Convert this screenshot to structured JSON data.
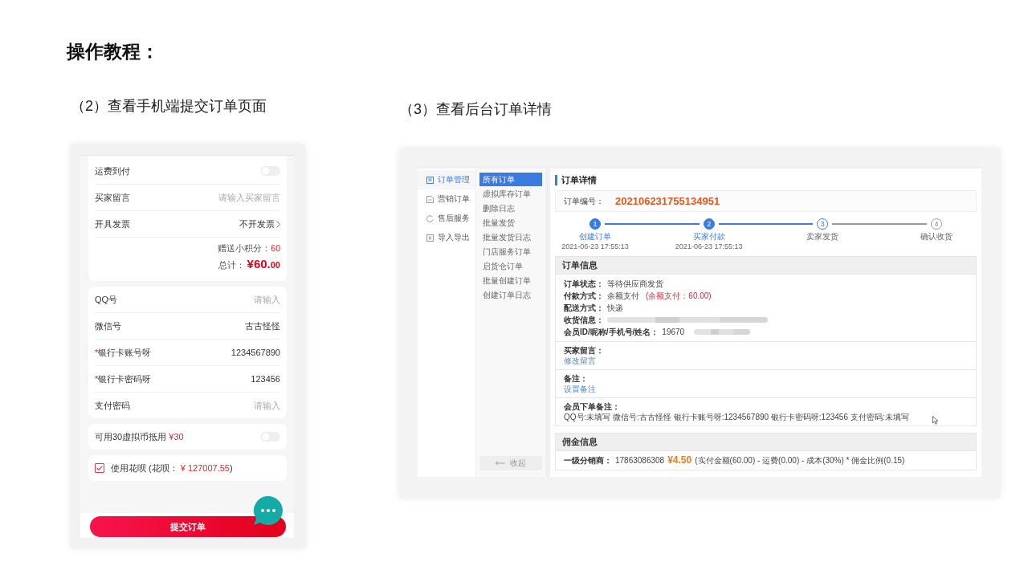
{
  "page_title": "操作教程：",
  "mobile": {
    "caption": "（2）查看手机端提交订单页面",
    "cards": [
      {
        "rows": [
          {
            "kind": "toggle",
            "label": "运费到付",
            "on": false
          },
          {
            "kind": "input",
            "label": "买家留言",
            "placeholder": "请输入买家留言"
          },
          {
            "kind": "select",
            "label": "开具发票",
            "value": "不开发票"
          }
        ],
        "summary": {
          "points_label": "赠送小积分：",
          "points": "60",
          "total_label": "总计：",
          "total_amount": "¥60.",
          "total_cents": "00"
        }
      },
      {
        "rows": [
          {
            "kind": "input",
            "label": "QQ号",
            "placeholder": "请输入"
          },
          {
            "kind": "input",
            "label": "微信号",
            "value": "古古怪怪"
          },
          {
            "kind": "input",
            "label": "银行卡账号呀",
            "required_mark": "*",
            "value": "1234567890"
          },
          {
            "kind": "input",
            "label": "银行卡密码呀",
            "required_mark": "*",
            "value": "123456"
          },
          {
            "kind": "input",
            "label": "支付密码",
            "placeholder": "请输入"
          }
        ]
      },
      {
        "rows": [
          {
            "kind": "toggle",
            "label": "可用30虚拟币抵用",
            "amount": "¥30",
            "on": false
          }
        ]
      },
      {
        "rows": [
          {
            "kind": "check",
            "label": "使用花呗 (花呗：",
            "amount": "¥ 127007.55",
            "suffix": ")",
            "checked": true
          }
        ]
      }
    ],
    "submit_button": "提交订单"
  },
  "admin": {
    "caption": "（3）查看后台订单详情",
    "main_nav": [
      {
        "label": "订单管理",
        "selected": true
      },
      {
        "label": "营销订单",
        "selected": false
      },
      {
        "label": "售后服务",
        "selected": false
      },
      {
        "label": "导入导出",
        "selected": false
      }
    ],
    "sub_nav": [
      {
        "label": "所有订单",
        "selected": true
      },
      {
        "label": "虚拟库存订单",
        "selected": false
      },
      {
        "label": "删除日志",
        "selected": false
      },
      {
        "label": "批量发货",
        "selected": false
      },
      {
        "label": "批量发货日志",
        "selected": false
      },
      {
        "label": "门店服务订单",
        "selected": false
      },
      {
        "label": "启货仓订单",
        "selected": false
      },
      {
        "label": "批量创建订单",
        "selected": false
      },
      {
        "label": "创建订单日志",
        "selected": false
      }
    ],
    "collapse_button": "收起",
    "detail": {
      "title": "订单详情",
      "order_number_label": "订单编号：",
      "order_number": "202106231755134951",
      "steps": [
        {
          "number": "1",
          "label": "创建订单",
          "time": "2021-06-23 17:55:13",
          "done": true,
          "active": false
        },
        {
          "number": "2",
          "label": "买家付款",
          "time": "2021-06-23 17:55:13",
          "done": true,
          "active": false
        },
        {
          "number": "3",
          "label": "卖家发货",
          "done": false,
          "active": true
        },
        {
          "number": "4",
          "label": "确认收货",
          "done": false,
          "active": false
        }
      ],
      "order_info": {
        "title": "订单信息",
        "rows": [
          {
            "label": "订单状态：",
            "value": "等待供应商发货"
          },
          {
            "label": "付款方式：",
            "value": "余额支付",
            "note": "(余额支付：60.00)"
          },
          {
            "label": "配送方式：",
            "value": "快递"
          },
          {
            "label": "收货信息：",
            "redacted": true
          },
          {
            "label": "会员ID/昵称/手机号/姓名：",
            "value": "19670",
            "redacted": true
          }
        ],
        "remarks": [
          {
            "kind": "link",
            "label": "买家留言：",
            "link": "修改留言"
          },
          {
            "kind": "link",
            "label": "备注：",
            "link": "设置备注"
          },
          {
            "kind": "text",
            "label": "会员下单备注：",
            "text": "QQ号:未填写 微信号:古古怪怪 银行卡账号呀:1234567890 银行卡密码呀:123456 支付密码:未填写"
          }
        ]
      },
      "commission": {
        "title": "佣金信息",
        "rows": [
          {
            "label": "一级分销商：",
            "phone": "17863086308",
            "amount": "¥4.50",
            "formula": "(实付金额(60.00) - 运费(0.00) - 成本(30%) * 佣金比例(0.15)"
          }
        ]
      }
    }
  }
}
